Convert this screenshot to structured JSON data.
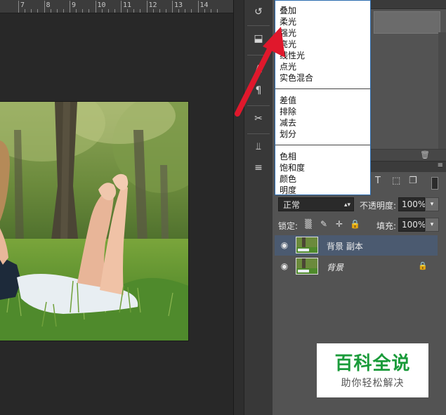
{
  "ruler": {
    "labels": [
      "7",
      "8",
      "9",
      "10",
      "11",
      "12",
      "13",
      "14"
    ]
  },
  "blend_menu": {
    "groups": [
      [
        "叠加",
        "柔光",
        "强光",
        "亮光",
        "线性光",
        "点光",
        "实色混合"
      ],
      [
        "差值",
        "排除",
        "减去",
        "划分"
      ],
      [
        "色相",
        "饱和度",
        "颜色",
        "明度"
      ]
    ]
  },
  "layers_panel": {
    "blend_mode": "正常",
    "opacity_label": "不透明度:",
    "opacity_value": "100%",
    "lock_label": "锁定:",
    "fill_label": "填充:",
    "fill_value": "100%",
    "layers": [
      {
        "name": "背景 副本",
        "selected": true,
        "locked": false
      },
      {
        "name": "背景",
        "selected": false,
        "locked": true
      }
    ]
  },
  "watermark": {
    "title": "百科全说",
    "subtitle": "助你轻松解决"
  },
  "colors": {
    "accent_arrow": "#e0182c",
    "selected_layer": "#4b5a70",
    "watermark_green": "#1a9b3a"
  },
  "icons": [
    "history-icon",
    "clone-source-icon",
    "character-icon",
    "paragraph-icon",
    "tools-icon",
    "brush-presets-icon",
    "adjust-icon",
    "type-filter-icon",
    "shape-filter-icon",
    "smart-object-filter-icon",
    "eye-icon",
    "lock-icon",
    "trash-icon"
  ]
}
